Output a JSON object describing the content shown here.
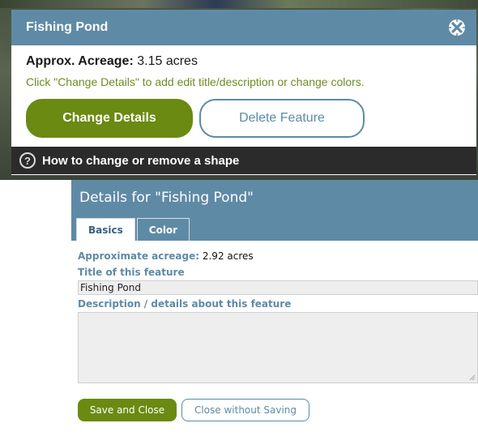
{
  "popup": {
    "title": "Fishing Pond",
    "acreage_label": "Approx. Acreage:",
    "acreage_value": "3.15 acres",
    "hint": "Click \"Change Details\" to add edit title/description or change colors.",
    "change_details_label": "Change Details",
    "delete_feature_label": "Delete Feature",
    "help_icon_glyph": "?",
    "help_text": "How to change or remove a shape",
    "close_icon": "close-x-icon"
  },
  "details": {
    "title": "Details for \"Fishing Pond\"",
    "tabs": [
      {
        "label": "Basics",
        "active": true
      },
      {
        "label": "Color",
        "active": false
      }
    ],
    "acreage_label": "Approximate acreage:",
    "acreage_value": "2.92 acres",
    "title_label": "Title of this feature",
    "title_value": "Fishing Pond",
    "description_label": "Description / details about this feature",
    "description_value": "",
    "save_label": "Save and Close",
    "close_label": "Close without Saving"
  },
  "colors": {
    "header": "#5f8aa6",
    "accent_green": "#6a8a12",
    "hint_green": "#6b8e23",
    "help_bar": "#2b2b2b"
  }
}
